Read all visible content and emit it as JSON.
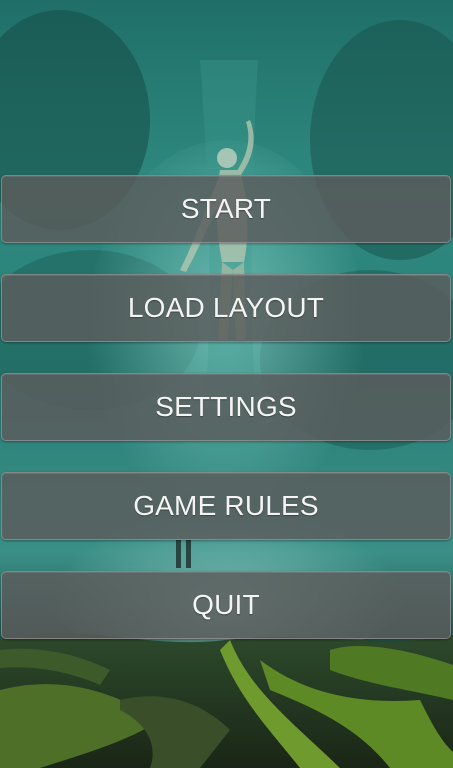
{
  "menu": {
    "start_label": "START",
    "load_layout_label": "LOAD LAYOUT",
    "settings_label": "SETTINGS",
    "game_rules_label": "GAME RULES",
    "quit_label": "QUIT"
  },
  "colors": {
    "button_fill": "#5c5c5c",
    "button_text": "#f4f4f4",
    "background_teal": "#2e8f86",
    "moss_green": "#6f9a2e"
  }
}
